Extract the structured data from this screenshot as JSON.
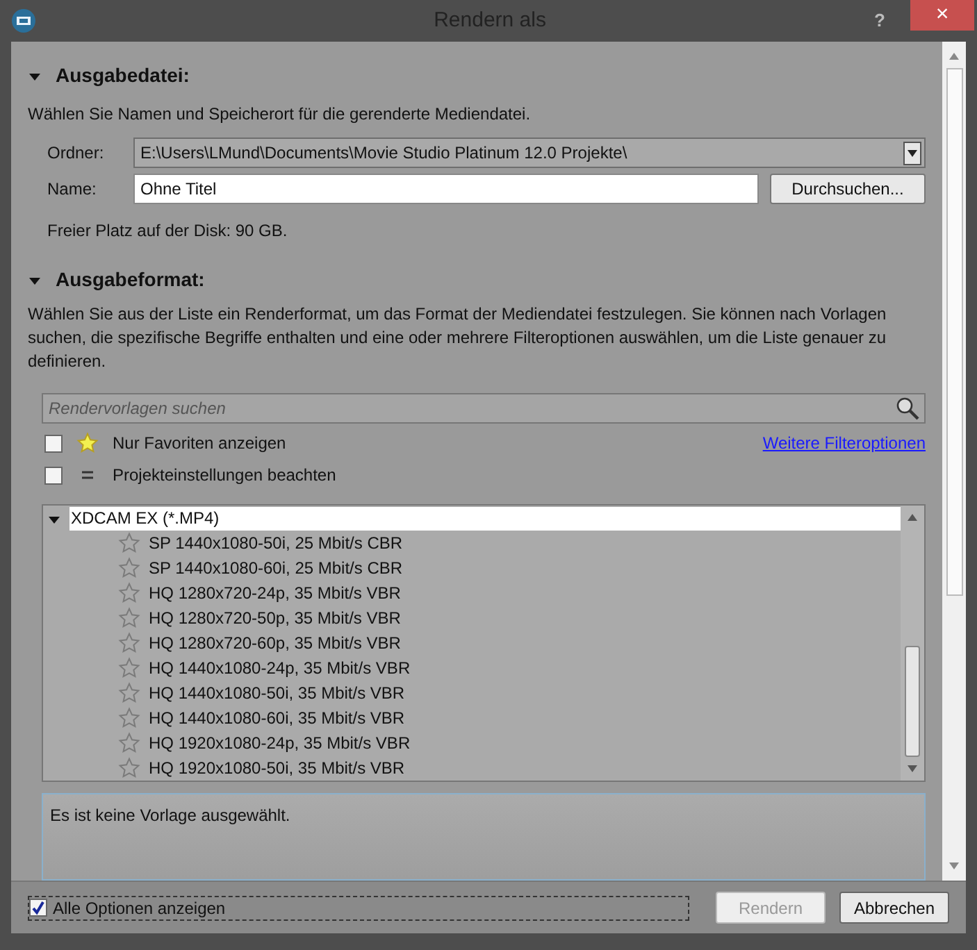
{
  "window": {
    "title": "Rendern als",
    "help": "?",
    "close": "×"
  },
  "output_file": {
    "heading": "Ausgabedatei:",
    "expanded": true,
    "description": "Wählen Sie Namen und Speicherort für die gerenderte Mediendatei.",
    "folder_label": "Ordner:",
    "folder_value": "E:\\Users\\LMund\\Documents\\Movie Studio Platinum 12.0 Projekte\\",
    "name_label": "Name:",
    "name_value": "Ohne Titel",
    "browse_button": "Durchsuchen...",
    "free_space": "Freier Platz auf der Disk: 90 GB."
  },
  "output_format": {
    "heading": "Ausgabeformat:",
    "expanded": true,
    "description": "Wählen Sie aus der Liste ein Renderformat, um das Format der Mediendatei festzulegen. Sie können nach Vorlagen suchen, die spezifische Begriffe enthalten und eine oder mehrere Filteroptionen auswählen, um die Liste genauer zu definieren.",
    "search_placeholder": "Rendervorlagen suchen",
    "filters": [
      {
        "kind": "star",
        "label": "Nur Favoriten anzeigen",
        "checked": false
      },
      {
        "kind": "equals",
        "label": "Projekteinstellungen beachten",
        "checked": false
      }
    ],
    "more_filters_link": "Weitere Filteroptionen",
    "tree": [
      {
        "label": "XDCAM EX (*.MP4)",
        "expanded": true,
        "selected": true,
        "children": [
          {
            "label": "SP 1440x1080-50i, 25 Mbit/s CBR",
            "favorite": false,
            "selected": false
          },
          {
            "label": "SP 1440x1080-60i, 25 Mbit/s CBR",
            "favorite": false,
            "selected": false
          },
          {
            "label": "HQ 1280x720-24p, 35 Mbit/s VBR",
            "favorite": false,
            "selected": false
          },
          {
            "label": "HQ 1280x720-50p, 35 Mbit/s VBR",
            "favorite": false,
            "selected": false
          },
          {
            "label": "HQ 1280x720-60p, 35 Mbit/s VBR",
            "favorite": false,
            "selected": false
          },
          {
            "label": "HQ 1440x1080-24p, 35 Mbit/s VBR",
            "favorite": false,
            "selected": false
          },
          {
            "label": "HQ 1440x1080-50i, 35 Mbit/s VBR",
            "favorite": false,
            "selected": false
          },
          {
            "label": "HQ 1440x1080-60i, 35 Mbit/s VBR",
            "favorite": false,
            "selected": false
          },
          {
            "label": "HQ 1920x1080-24p, 35 Mbit/s VBR",
            "favorite": false,
            "selected": false
          },
          {
            "label": "HQ 1920x1080-50i, 35 Mbit/s VBR",
            "favorite": false,
            "selected": false
          }
        ]
      }
    ],
    "info_text": "Es ist keine Vorlage ausgewählt."
  },
  "footer": {
    "show_all_label": "Alle Optionen anzeigen",
    "show_all_checked": true,
    "render_button": {
      "label": "Rendern",
      "disabled": true
    },
    "cancel_button": {
      "label": "Abbrechen",
      "disabled": false
    }
  }
}
